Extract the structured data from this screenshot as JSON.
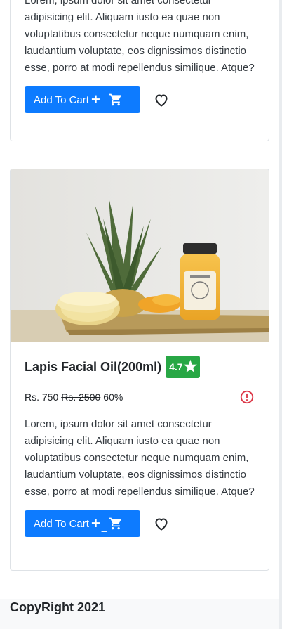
{
  "products": [
    {
      "description": "Lorem, ipsum dolor sit amet consectetur adipisicing elit. Aliquam iusto ea quae non voluptatibus consectetur neque numquam enim, laudantium voluptate, eos dignissimos distinctio esse, porro at modi repellendus similique. Atque?",
      "add_to_cart_label": "Add To Cart",
      "plus_symbol": "+",
      "minus_symbol": "_"
    },
    {
      "title": "Lapis Facial Oil(200ml)",
      "rating": "4.7",
      "rating_star": "★",
      "price": "Rs. 750",
      "original_price": "Rs. 2500",
      "discount": "60%",
      "description": "Lorem, ipsum dolor sit amet consectetur adipisicing elit. Aliquam iusto ea quae non voluptatibus consectetur neque numquam enim, laudantium voluptate, eos dignissimos distinctio esse, porro at modi repellendus similique. Atque?",
      "add_to_cart_label": "Add To Cart",
      "plus_symbol": "+",
      "minus_symbol": "_",
      "image_icon": "pineapple-juice-product-image"
    }
  ],
  "icons": {
    "cart": "shopping-cart-icon",
    "wishlist": "heart-outline-icon",
    "info": "alert-circle-icon"
  },
  "colors": {
    "primary_button": "#0d7bff",
    "rating_badge": "#28a745",
    "alert_icon": "#dc3545"
  },
  "footer": {
    "text": "CopyRight 2021"
  }
}
